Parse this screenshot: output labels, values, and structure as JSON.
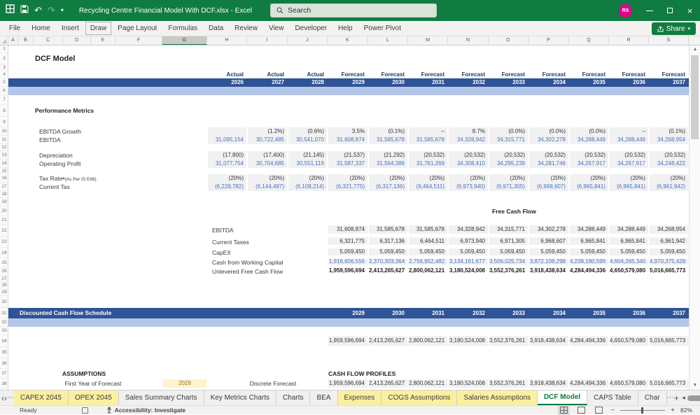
{
  "window": {
    "title": "Recycling Centre Financial Model With DCF.xlsx  -  Excel",
    "search_placeholder": "Search",
    "avatar_initials": "RS"
  },
  "ribbon": {
    "tabs": [
      "File",
      "Home",
      "Insert",
      "Draw",
      "Page Layout",
      "Formulas",
      "Data",
      "Review",
      "View",
      "Developer",
      "Help",
      "Power Pivot"
    ],
    "focused_tab": "Draw",
    "share_label": "Share"
  },
  "grid": {
    "columns": [
      "A",
      "B",
      "C",
      "D",
      "E",
      "F",
      "G",
      "H",
      "I",
      "J",
      "K",
      "L",
      "M",
      "N",
      "O",
      "P",
      "Q",
      "R",
      "S"
    ],
    "selected_column": "G",
    "row_count": 38
  },
  "sheet": {
    "title": "DCF Model",
    "period_types": [
      "Actual",
      "Actual",
      "Actual",
      "Forecast",
      "Forecast",
      "Forecast",
      "Forecast",
      "Forecast",
      "Forecast",
      "Forecast",
      "Forecast",
      "Forecast"
    ],
    "period_years": [
      "2026",
      "2027",
      "2028",
      "2029",
      "2030",
      "2031",
      "2032",
      "2033",
      "2034",
      "2035",
      "2036",
      "2037"
    ],
    "performance": {
      "heading": "Performance Metrics",
      "rows": [
        {
          "label": "EBITDA Growth",
          "values": [
            "",
            "(1.2%)",
            "(0.6%)",
            "3.5%",
            "(0.1%)",
            "–",
            "8.7%",
            "(0.0%)",
            "(0.0%)",
            "(0.0%)",
            "–",
            "(0.1%)"
          ]
        },
        {
          "label": "EBITDA",
          "blue": true,
          "values": [
            "31,095,154",
            "30,722,485",
            "30,541,070",
            "31,608,874",
            "31,585,678",
            "31,585,678",
            "34,328,942",
            "34,315,771",
            "34,302,278",
            "34,288,449",
            "34,288,449",
            "34,268,954"
          ]
        },
        {
          "label": "Depreciation",
          "values": [
            "(17,800)",
            "(17,400)",
            "(21,145)",
            "(21,537)",
            "(21,292)",
            "(20,532)",
            "(20,532)",
            "(20,532)",
            "(20,532)",
            "(20,532)",
            "(20,532)",
            "(20,532)"
          ]
        },
        {
          "label": "Operating Profit",
          "blue": true,
          "values": [
            "31,077,754",
            "30,704,685",
            "30,551,119",
            "31,587,337",
            "31,564,386",
            "31,761,269",
            "34,308,410",
            "34,295,239",
            "34,281,746",
            "34,267,917",
            "34,267,917",
            "34,248,422"
          ]
        },
        {
          "label": "Tax Rate",
          "note": "(As Per IS E69)",
          "values": [
            "(20%)",
            "(20%)",
            "(20%)",
            "(20%)",
            "(20%)",
            "(20%)",
            "(20%)",
            "(20%)",
            "(20%)",
            "(20%)",
            "(20%)",
            "(20%)"
          ]
        },
        {
          "label": "Current Tax",
          "blue": true,
          "values": [
            "(6,228,782)",
            "(6,144,497)",
            "(6,108,214)",
            "(6,321,775)",
            "(6,317,136)",
            "(6,464,511)",
            "(6,973,940)",
            "(6,971,305)",
            "(6,968,607)",
            "(6,965,841)",
            "(6,965,841)",
            "(6,961,942)"
          ]
        }
      ]
    },
    "free_cash_flow": {
      "heading": "Free Cash Flow",
      "rows": [
        {
          "label": "EBITDA",
          "values": [
            "31,608,874",
            "31,585,678",
            "31,585,678",
            "34,328,942",
            "34,315,771",
            "34,302,278",
            "34,288,449",
            "34,288,449",
            "34,268,954"
          ]
        },
        {
          "label": "Current Taxes",
          "values": [
            "6,321,775",
            "6,317,136",
            "6,464,511",
            "6,973,940",
            "6,971,305",
            "6,968,607",
            "6,965,841",
            "6,965,841",
            "6,961,942"
          ]
        },
        {
          "label": "CapEX",
          "values": [
            "5,059,450",
            "5,059,450",
            "5,059,450",
            "5,059,450",
            "5,059,450",
            "5,059,450",
            "5,059,450",
            "5,059,450",
            "5,059,450"
          ]
        },
        {
          "label": "Cash from Working Capital",
          "blue": true,
          "values": [
            "1,916,606,556",
            "2,370,303,364",
            "2,756,952,482",
            "3,134,161,677",
            "3,506,025,734",
            "3,872,108,298",
            "4,238,180,596",
            "4,604,265,340",
            "4,970,375,428"
          ]
        },
        {
          "label": "Unlevered Free Cash Flow",
          "total": true,
          "values": [
            "1,959,596,694",
            "2,413,265,627",
            "2,800,062,121",
            "3,180,524,008",
            "3,552,376,261",
            "3,918,438,634",
            "4,284,494,336",
            "4,650,579,080",
            "5,016,665,773"
          ]
        }
      ]
    },
    "dcf_schedule": {
      "heading": "Discounted Cash Flow Schedule",
      "years": [
        "2029",
        "2030",
        "2031",
        "2032",
        "2033",
        "2034",
        "2035",
        "2036",
        "2037"
      ],
      "values": [
        "1,959,596,694",
        "2,413,265,627",
        "2,800,062,121",
        "3,180,524,008",
        "3,552,376,261",
        "3,918,438,634",
        "4,284,494,336",
        "4,650,579,080",
        "5,016,665,773"
      ]
    },
    "assumptions": {
      "heading": "ASSUMPTIONS",
      "first_year_label": "First Year of Forecast",
      "first_year_value": "2028",
      "forecast_type": "Discrete Forecast"
    },
    "cash_flow_profiles": {
      "heading": "CASH FLOW PROFILES",
      "values": [
        "1,959,596,694",
        "2,413,265,627",
        "2,800,062,121",
        "3,180,524,008",
        "3,552,376,261",
        "3,918,438,634",
        "4,284,494,336",
        "4,650,579,080",
        "5,016,665,773"
      ]
    }
  },
  "sheet_tabs": {
    "tabs": [
      {
        "label": "CAPEX 2045",
        "highlight": true
      },
      {
        "label": "OPEX 2045",
        "highlight": true
      },
      {
        "label": "Sales Summary Charts"
      },
      {
        "label": "Key Metrics Charts"
      },
      {
        "label": "Charts"
      },
      {
        "label": "BEA"
      },
      {
        "label": "Expenses",
        "highlight": true
      },
      {
        "label": "COGS Assumptions",
        "highlight": true
      },
      {
        "label": "Salaries Assumptions",
        "highlight": true
      },
      {
        "label": "DCF Model",
        "active": true
      },
      {
        "label": "CAPS Table"
      },
      {
        "label": "Char"
      }
    ]
  },
  "status_bar": {
    "ready": "Ready",
    "accessibility": "Accessibility: Investigate",
    "zoom": "82%"
  }
}
